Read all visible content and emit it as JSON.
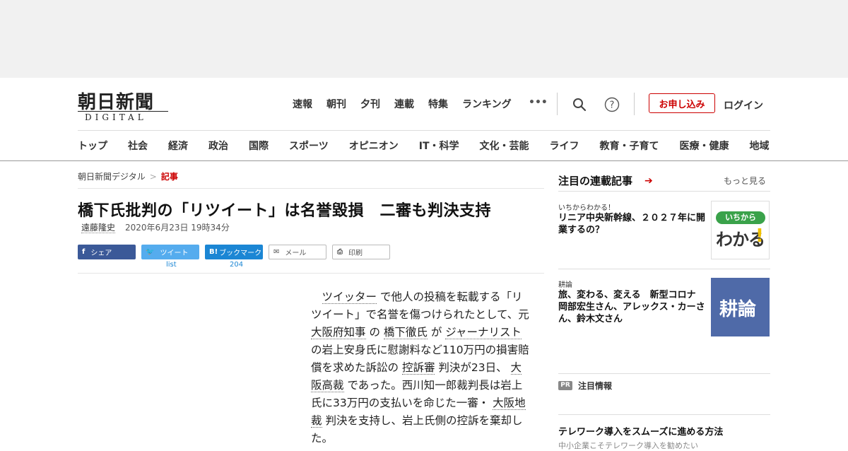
{
  "logo": {
    "main": "朝日新聞",
    "sub": "DIGITAL"
  },
  "topnav": [
    "速報",
    "朝刊",
    "夕刊",
    "連載",
    "特集",
    "ランキング"
  ],
  "topnav_more": "•••",
  "header": {
    "apply_label": "お申し込み",
    "login_label": "ログイン"
  },
  "catnav": [
    "トップ",
    "社会",
    "経済",
    "政治",
    "国際",
    "スポーツ",
    "オピニオン",
    "IT・科学",
    "文化・芸能",
    "ライフ",
    "教育・子育て",
    "医療・健康",
    "地域"
  ],
  "breadcrumb": {
    "home": "朝日新聞デジタル",
    "sep": ">",
    "current": "記事"
  },
  "article": {
    "headline": "橋下氏批判の「リツイート」は名誉毀損　二審も判決支持",
    "author": "遠藤隆史",
    "date": "2020年6月23日 19時34分"
  },
  "share": {
    "facebook": "シェア",
    "twitter": "ツイート",
    "hatena": "ブックマーク",
    "mail": "メール",
    "print": "印刷",
    "twitter_count": "list",
    "hatena_count": "204"
  },
  "body": {
    "s1_lead": "",
    "w_twitter": "ツイッター",
    "s1": " で他人の投稿を転載する「リツイート」で名誉を傷つけられたとして、元 ",
    "w_gov": "大阪府知事",
    "s2": " の ",
    "w_hashimoto": "橋下徹氏",
    "s3": " が ",
    "w_journalist": "ジャーナリスト",
    "s4": " の岩上安身氏に慰謝料など110万円の損害賠償を求めた訴訟の ",
    "w_appeal": "控訴審",
    "s5": " 判決が23日、 ",
    "w_high": "大阪高裁",
    "s6": " であった。西川知一郎裁判長は岩上氏に33万円の支払いを命じた一審・ ",
    "w_district": "大阪地裁",
    "s7": " 判決を支持し、岩上氏側の控訴を棄却した。"
  },
  "sidebar": {
    "title": "注目の連載記事",
    "more": "もっと見る",
    "card1": {
      "sub": "いちからわかる！",
      "title": "リニア中央新幹線、２０２７年に開業するの？",
      "thumb_top": "いちから",
      "thumb_main": "わかる",
      "thumb_ex": "!"
    },
    "card2": {
      "sub": "耕論",
      "title": "旅、変わる、変える　新型コロナ　岡部宏生さん、アレックス・カーさん、鈴木文さん",
      "thumb": "耕論"
    },
    "pr_badge": "PR",
    "pr_label": "注目情報",
    "bottom_title": "テレワーク導入をスムーズに進める方法",
    "bottom_sub": "中小企業こそテレワーク導入を勧めたい"
  },
  "colors": {
    "accent": "#cc0000",
    "facebook": "#3b5998",
    "twitter": "#55acee",
    "hatena": "#1b86d4"
  }
}
